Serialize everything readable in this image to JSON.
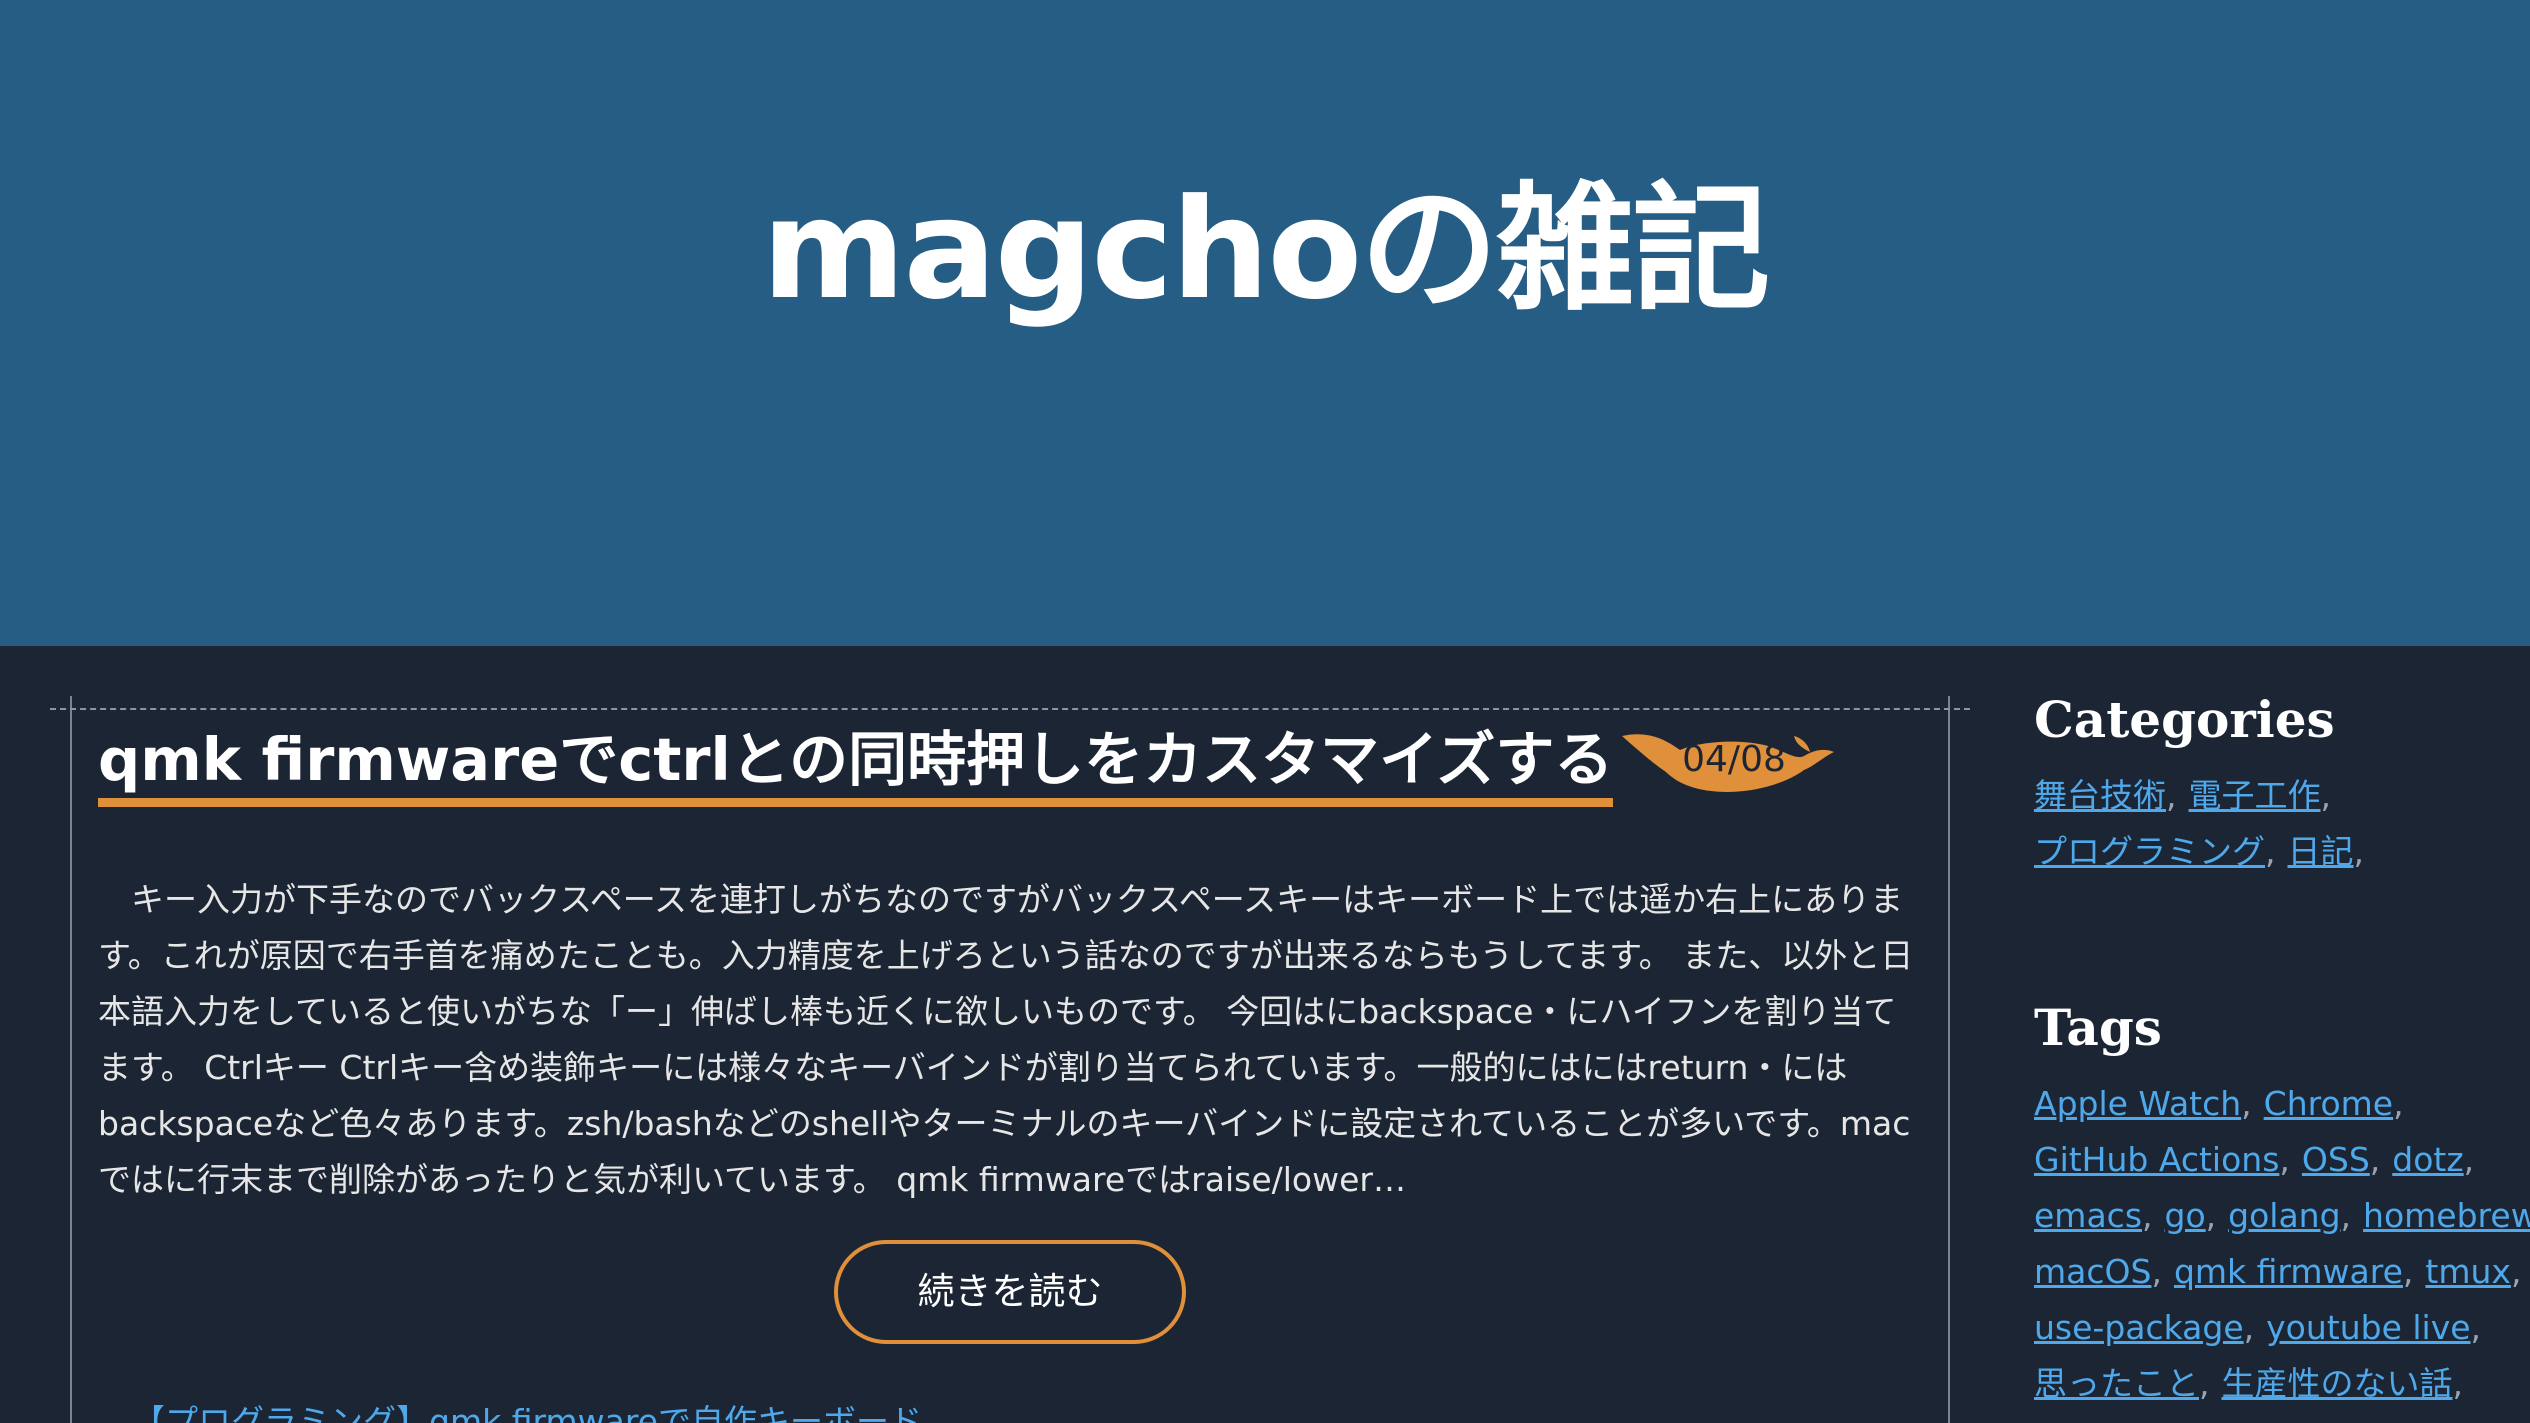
{
  "site": {
    "title": "magchoの雑記"
  },
  "entry": {
    "title": "qmk firmwareでctrlとの同時押しをカスタマイズする",
    "date": "04/08",
    "summary_lines": [
      "　キー入力が下手なのでバックスペースを連打しがちなのですがバックスペースキーはキーボード上では遥か右上にありま",
      "す。これが原因で右手首を痛めたことも。入力精度を上げろという話なのですが出来るならもうしてます。 また、以外と日",
      "本語入力をしていると使いがちな「ー」伸ばし棒も近くに欲しいものです。 今回はにbackspace・にハイフンを割り当て",
      "ます。 Ctrlキー Ctrlキー含め装飾キーには様々なキーバインドが割り当てられています。一般的にはにはreturn・には",
      "backspaceなど色々あります。zsh/bashなどのshellやターミナルのキーバインドに設定されていることが多いです。mac",
      "ではに行末まで削除があったりと気が利いています。 qmk firmwareではraise/lower…"
    ],
    "read_more_label": "続きを読む",
    "next_entry_text": "【プログラミング】qmk firmwareで自作キーボード"
  },
  "sidebar": {
    "categories": {
      "heading": "Categories",
      "items": [
        "舞台技術",
        "電子工作",
        "プログラミング",
        "日記"
      ]
    },
    "tags": {
      "heading": "Tags",
      "items": [
        "Apple Watch",
        "Chrome",
        "GitHub Actions",
        "OSS",
        "dotz",
        "emacs",
        "go",
        "golang",
        "homebrew",
        "macOS",
        "qmk firmware",
        "tmux",
        "use-package",
        "youtube live",
        "思ったこと",
        "生産性のない話"
      ]
    }
  },
  "colors": {
    "header_bg": "#255d84",
    "body_bg": "#1c2533",
    "accent": "#e08f3a",
    "link": "#4fa8ea"
  }
}
